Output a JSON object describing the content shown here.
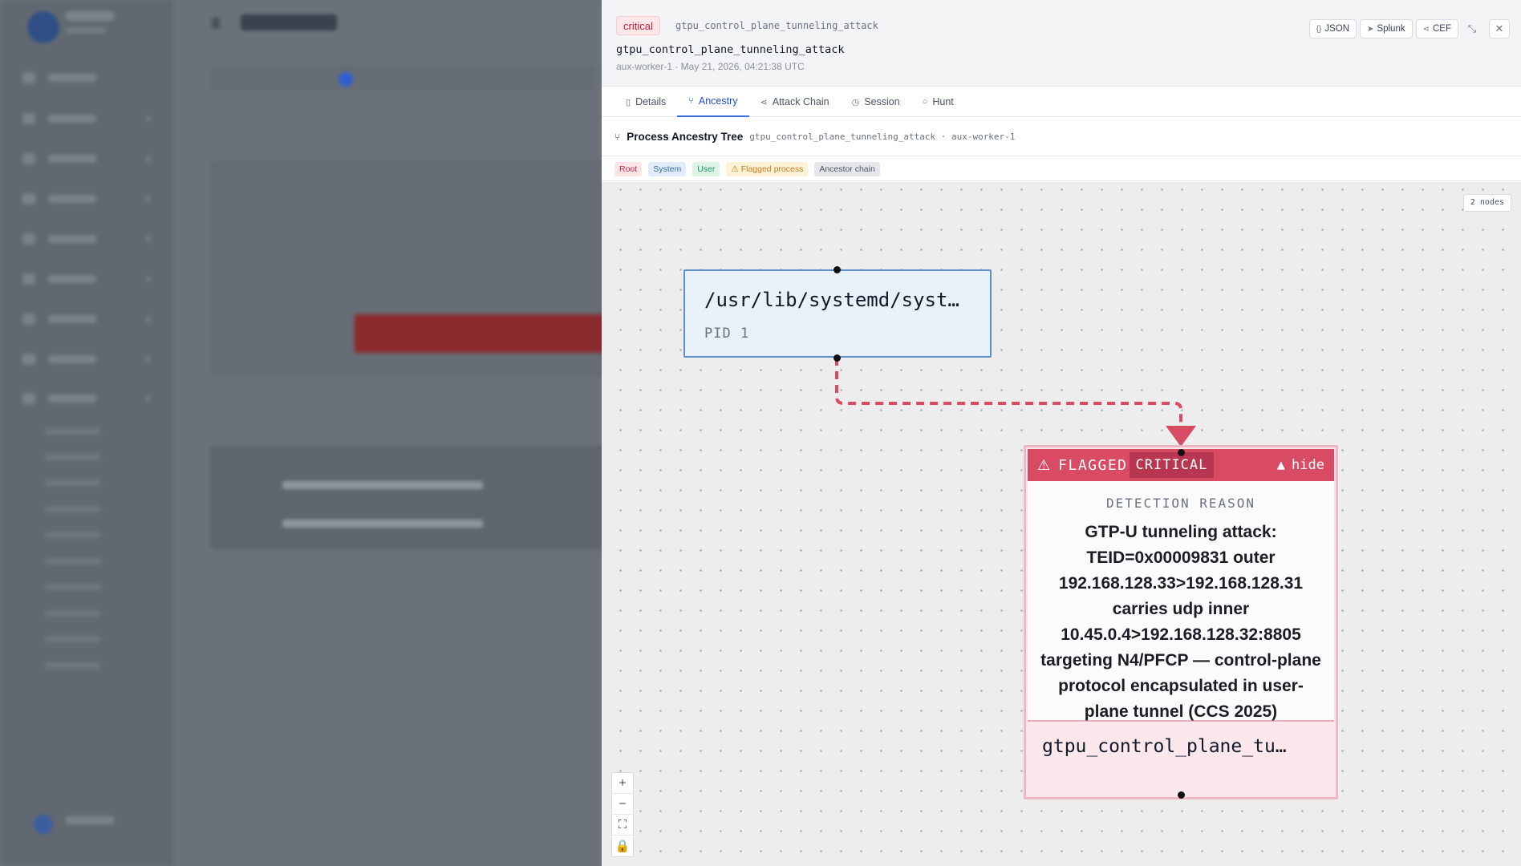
{
  "detail": {
    "severity": "critical",
    "detection_slug": "gtpu_control_plane_tunneling_attack",
    "title": "gtpu_control_plane_tunneling_attack",
    "meta": "aux-worker-1 · May 21, 2026, 04:21:38 UTC",
    "exports": [
      {
        "label": "JSON",
        "icon": "braces-icon"
      },
      {
        "label": "Splunk",
        "icon": "send-icon"
      },
      {
        "label": "CEF",
        "icon": "share-icon"
      }
    ]
  },
  "tabs": [
    {
      "label": "Details",
      "icon": "document-icon",
      "active": false
    },
    {
      "label": "Ancestry",
      "icon": "branch-icon",
      "active": true
    },
    {
      "label": "Attack Chain",
      "icon": "share-icon",
      "active": false
    },
    {
      "label": "Session",
      "icon": "clock-icon",
      "active": false
    },
    {
      "label": "Hunt",
      "icon": "circle-icon",
      "active": false
    }
  ],
  "tree": {
    "title": "Process Ancestry Tree",
    "subtitle": "gtpu_control_plane_tunneling_attack · aux-worker-1",
    "legend": {
      "root": "Root",
      "system": "System",
      "user": "User",
      "flagged": "⚠ Flagged process",
      "ancestor": "Ancestor chain"
    },
    "node_count": "2 nodes"
  },
  "nodes": {
    "system": {
      "path": "/usr/lib/systemd/syst…",
      "pid": "PID 1"
    },
    "flagged": {
      "header_label": "FLAGGED",
      "severity": "CRITICAL",
      "hide_label": "hide",
      "reason_label": "DETECTION REASON",
      "reason": "GTP-U tunneling attack: TEID=0x00009831 outer 192.168.128.33>192.168.128.31 carries udp inner 10.45.0.4>192.168.128.32:8805 targeting N4/PFCP — control-plane protocol encapsulated in user-plane tunnel (CCS 2025)",
      "process": "gtpu_control_plane_tu…"
    }
  },
  "zoom_controls": [
    "+",
    "−",
    "⛶",
    "🔒"
  ],
  "colors": {
    "critical": "#d94a63",
    "accent": "#3b6fe0",
    "system_border": "#5b8fc8",
    "edge": "#d94a63"
  }
}
